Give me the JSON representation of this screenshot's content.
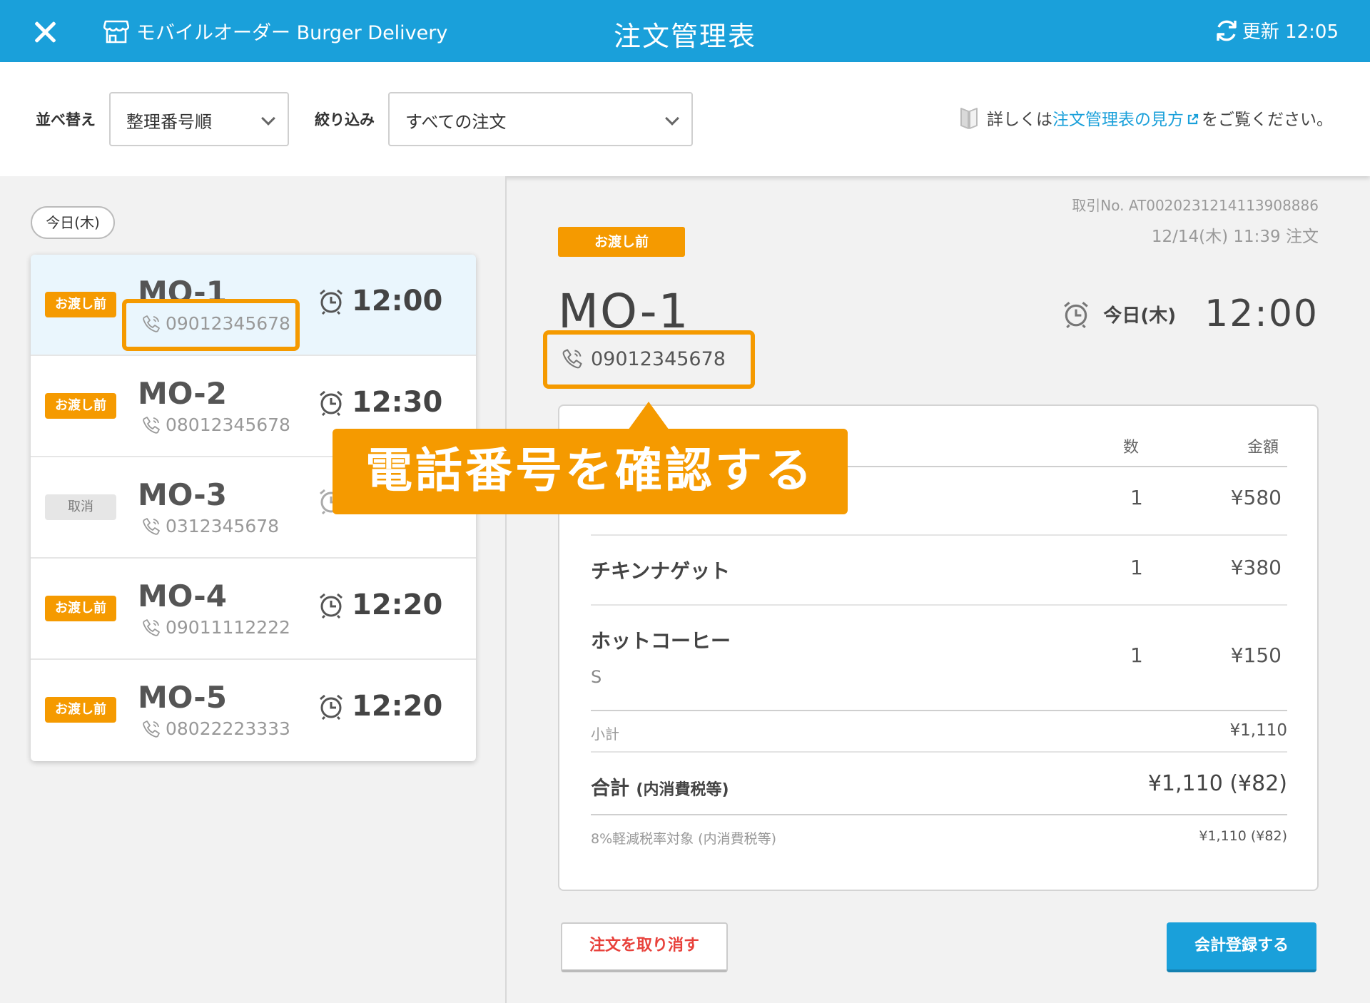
{
  "header": {
    "store_name": "モバイルオーダー Burger Delivery",
    "title": "注文管理表",
    "refresh_label": "更新 12:05"
  },
  "filters": {
    "sort_label": "並べ替え",
    "sort_value": "整理番号順",
    "filter_label": "絞り込み",
    "filter_value": "すべての注文",
    "help_prefix": "詳しくは",
    "help_link": "注文管理表の見方",
    "help_suffix": "をご覧ください。"
  },
  "order_list": {
    "day_label": "今日(木)",
    "orders": [
      {
        "status": "お渡し前",
        "id": "MO-1",
        "phone": "09012345678",
        "time": "12:00"
      },
      {
        "status": "お渡し前",
        "id": "MO-2",
        "phone": "08012345678",
        "time": "12:30"
      },
      {
        "status": "取消",
        "id": "MO-3",
        "phone": "0312345678",
        "time": ""
      },
      {
        "status": "お渡し前",
        "id": "MO-4",
        "phone": "09011112222",
        "time": "12:20"
      },
      {
        "status": "お渡し前",
        "id": "MO-5",
        "phone": "08022223333",
        "time": "12:20"
      }
    ]
  },
  "detail": {
    "transaction_no": "取引No. AT0020231214113908886",
    "ordered_at": "12/14(木)  11:39  注文",
    "status": "お渡し前",
    "order_id": "MO-1",
    "phone": "09012345678",
    "day": "今日(木)",
    "time": "12:00",
    "col_qty": "数",
    "col_amount": "金額",
    "items": [
      {
        "name": "",
        "option": "",
        "qty": "1",
        "price": "¥580"
      },
      {
        "name": "チキンナゲット",
        "option": "",
        "qty": "1",
        "price": "¥380"
      },
      {
        "name": "ホットコーヒー",
        "option": "S",
        "qty": "1",
        "price": "¥150"
      }
    ],
    "subtotal_label": "小計",
    "subtotal": "¥1,110",
    "total_label": "合計",
    "total_note": "(内消費税等)",
    "total": "¥1,110 (¥82)",
    "tax_label": "8%軽減税率対象 (内消費税等)",
    "tax_value": "¥1,110 (¥82)",
    "cancel_button": "注文を取り消す",
    "register_button": "会計登録する"
  },
  "annotation": {
    "callout_text": "電話番号を確認する"
  },
  "colors": {
    "header_blue": "#1aa0da",
    "accent_orange": "#f59a00",
    "cancel_red": "#e8413b"
  },
  "icons": [
    "close-icon",
    "store-icon",
    "refresh-icon",
    "help-book-icon",
    "external-link-icon",
    "phone-icon",
    "clock-icon",
    "chevron-down-icon"
  ]
}
